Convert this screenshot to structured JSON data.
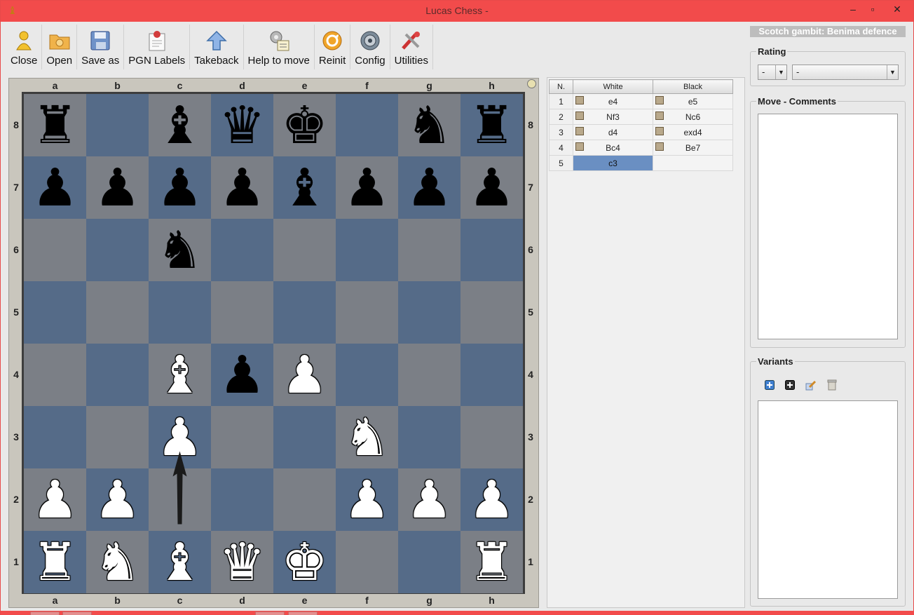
{
  "window": {
    "title": "Lucas Chess -",
    "min": "–",
    "max": "▫",
    "close": "✕"
  },
  "toolbar": [
    {
      "id": "close",
      "label": "Close",
      "icon": "person-icon"
    },
    {
      "id": "open",
      "label": "Open",
      "icon": "folder-icon"
    },
    {
      "id": "save-as",
      "label": "Save as",
      "icon": "disk-icon"
    },
    {
      "id": "pgn-labels",
      "label": "PGN Labels",
      "icon": "clipboard-icon"
    },
    {
      "id": "takeback",
      "label": "Takeback",
      "icon": "arrow-up-icon"
    },
    {
      "id": "help-to-move",
      "label": "Help to move",
      "icon": "gears-icon"
    },
    {
      "id": "reinit",
      "label": "Reinit",
      "icon": "refresh-icon"
    },
    {
      "id": "config",
      "label": "Config",
      "icon": "gear-icon"
    },
    {
      "id": "utilities",
      "label": "Utilities",
      "icon": "tools-icon"
    }
  ],
  "board": {
    "files": [
      "a",
      "b",
      "c",
      "d",
      "e",
      "f",
      "g",
      "h"
    ],
    "ranks": [
      "8",
      "7",
      "6",
      "5",
      "4",
      "3",
      "2",
      "1"
    ],
    "position": [
      [
        "br",
        "",
        "bb",
        "bq",
        "wk-black?",
        "",
        "bn",
        "br"
      ],
      [
        "bp",
        "bp",
        "bp",
        "bp",
        "bb",
        "bp",
        "bp",
        "bp"
      ],
      [
        "",
        "",
        "bn",
        "",
        "",
        "",
        "",
        ""
      ],
      [
        "",
        "",
        "",
        "",
        "",
        "",
        "",
        ""
      ],
      [
        "",
        "",
        "wb",
        "bp",
        "wp",
        "",
        "",
        ""
      ],
      [
        "",
        "",
        "wp",
        "",
        "",
        "wn",
        "",
        ""
      ],
      [
        "wp",
        "wp",
        "",
        "",
        "",
        "wp",
        "wp",
        "wp"
      ],
      [
        "wr",
        "wn",
        "wb",
        "wq",
        "wk",
        "",
        "",
        "wr"
      ]
    ],
    "last_move": {
      "from": "c2",
      "to": "c3"
    }
  },
  "moves": {
    "headers": {
      "num": "N.",
      "white": "White",
      "black": "Black"
    },
    "rows": [
      {
        "n": "1",
        "white": "e4",
        "black": "e5"
      },
      {
        "n": "2",
        "white": "Nf3",
        "black": "Nc6"
      },
      {
        "n": "3",
        "white": "d4",
        "black": "exd4"
      },
      {
        "n": "4",
        "white": "Bc4",
        "black": "Be7"
      },
      {
        "n": "5",
        "white": "c3",
        "black": ""
      }
    ]
  },
  "opening": "Scotch gambit: Benima defence",
  "rating": {
    "title": "Rating",
    "value1": "-",
    "value2": "-"
  },
  "comments": {
    "title": "Move - Comments"
  },
  "variants": {
    "title": "Variants"
  },
  "colors": {
    "light_square": "#7b7f86",
    "dark_square": "#556b88",
    "titlebar": "#f24b4b",
    "selection": "#6a8fc2"
  }
}
